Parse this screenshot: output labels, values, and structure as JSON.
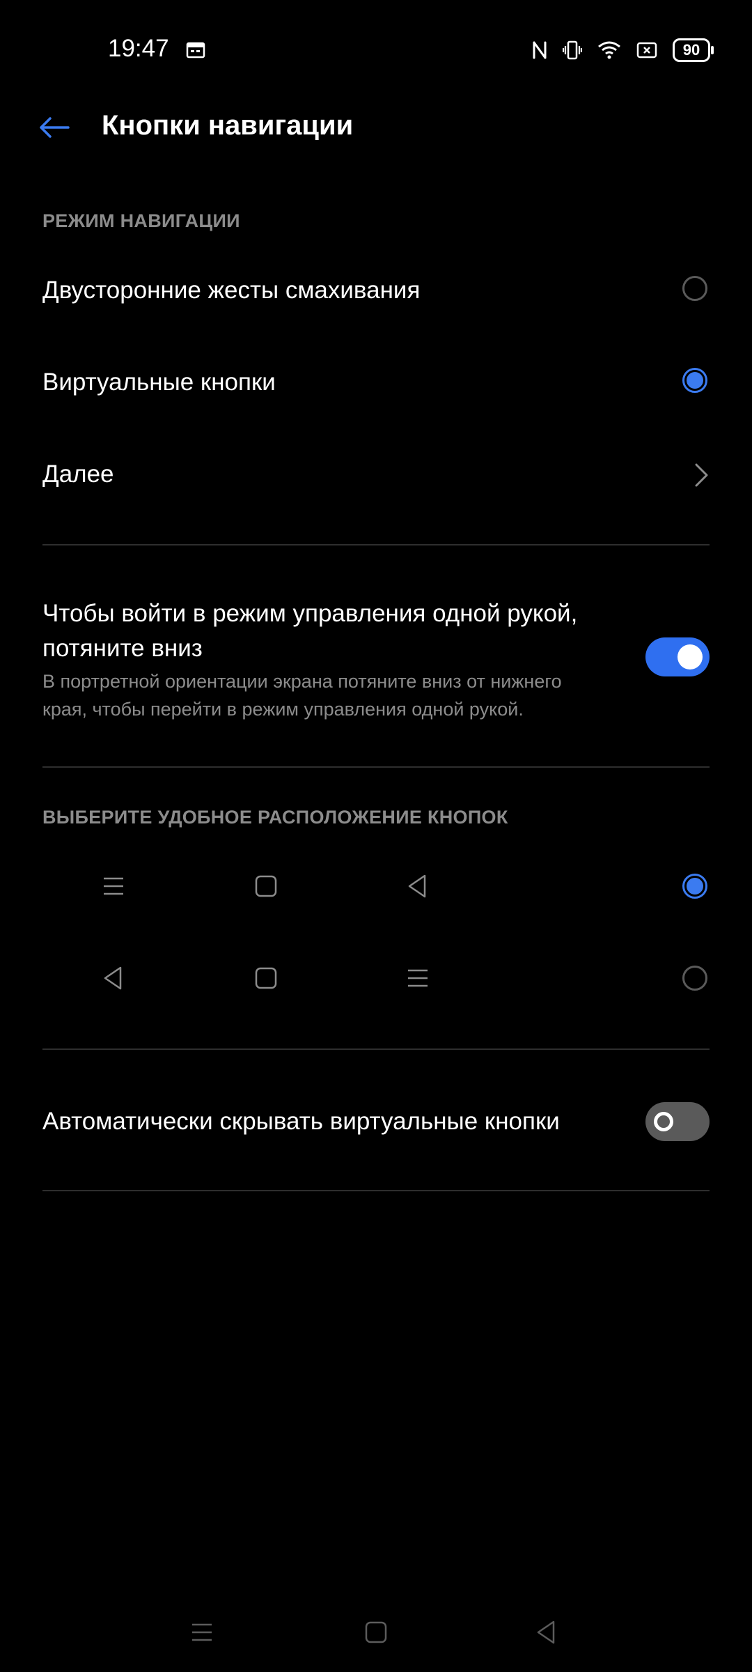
{
  "status_bar": {
    "time": "19:47",
    "battery": "90",
    "icons": [
      "calendar-icon",
      "nfc-icon",
      "vibrate-icon",
      "wifi-icon",
      "sim-icon",
      "battery-icon"
    ]
  },
  "header": {
    "title": "Кнопки навигации",
    "back_icon": "arrow-left-icon"
  },
  "navigation_mode": {
    "section_title": "РЕЖИМ НАВИГАЦИИ",
    "options": [
      {
        "label": "Двусторонние жесты смахивания",
        "selected": false
      },
      {
        "label": "Виртуальные кнопки",
        "selected": true
      }
    ],
    "more_label": "Далее"
  },
  "one_hand": {
    "title_line1": "Чтобы войти в режим управления одной рукой,",
    "title_line2": "потяните вниз",
    "description_line1": "В портретной ориентации экрана потяните вниз от нижнего",
    "description_line2": "края, чтобы перейти в режим управления одной рукой.",
    "enabled": true
  },
  "button_layout": {
    "section_title": "ВЫБЕРИТЕ УДОБНОЕ РАСПОЛОЖЕНИЕ КНОПОК",
    "options": [
      {
        "order": [
          "menu-icon",
          "home-icon",
          "back-icon"
        ],
        "selected": true
      },
      {
        "order": [
          "back-icon",
          "home-icon",
          "menu-icon"
        ],
        "selected": false
      }
    ]
  },
  "auto_hide": {
    "label": "Автоматически скрывать виртуальные кнопки",
    "enabled": false
  },
  "system_nav": {
    "buttons": [
      "menu-icon",
      "home-icon",
      "back-icon"
    ]
  },
  "colors": {
    "accent": "#3b7bf0",
    "background": "#000000",
    "secondary_text": "#8c8c8c"
  }
}
